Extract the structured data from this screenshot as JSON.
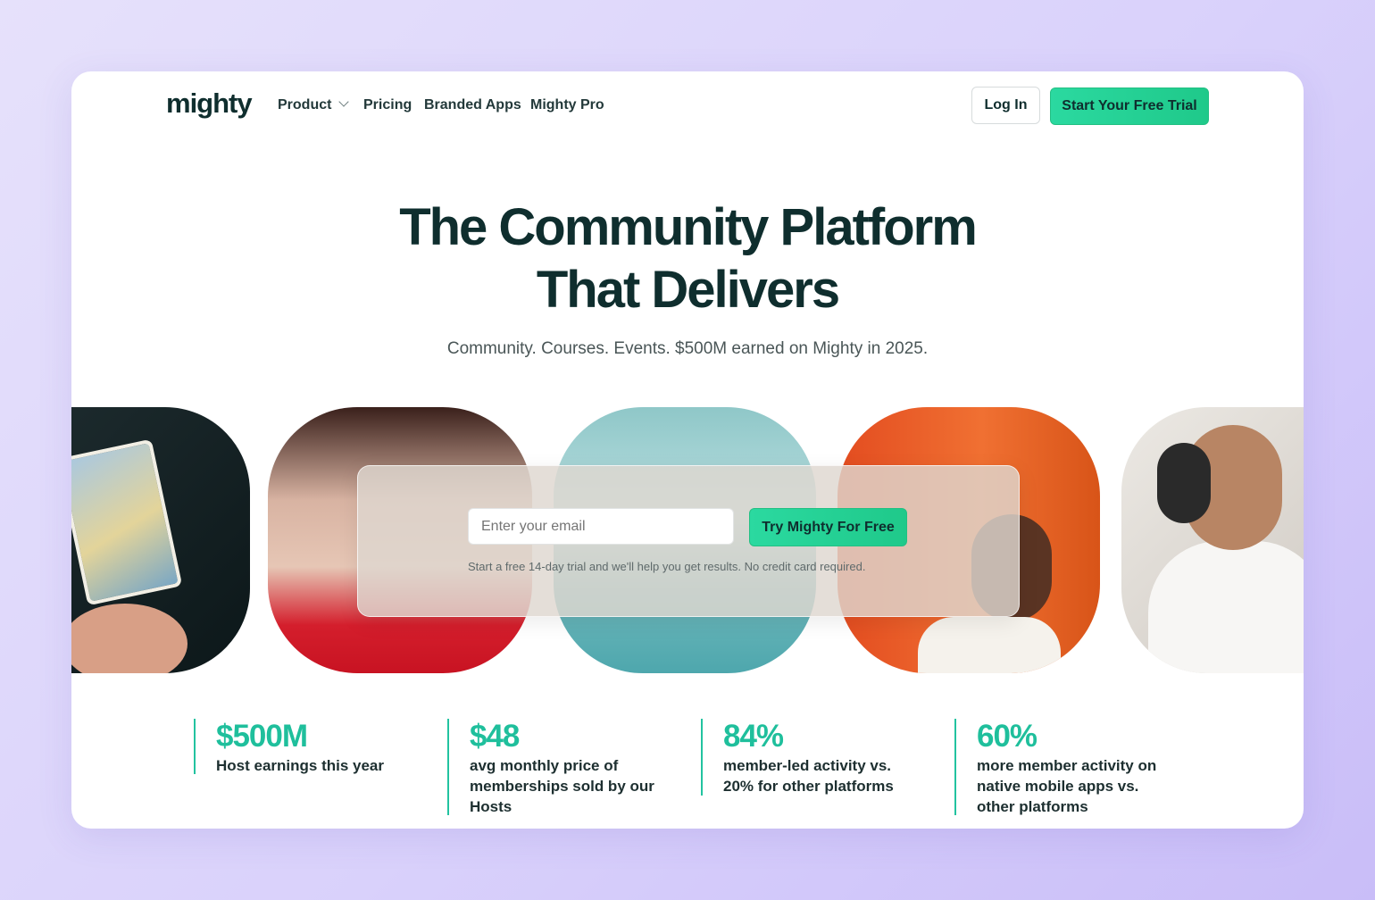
{
  "nav": {
    "logo": "mighty",
    "items": [
      {
        "label": "Product",
        "has_dropdown": true
      },
      {
        "label": "Pricing"
      },
      {
        "label": "Branded Apps"
      },
      {
        "label": "Mighty Pro"
      }
    ],
    "login_label": "Log In",
    "trial_label": "Start Your Free Trial"
  },
  "hero": {
    "title_line1": "The Community Platform",
    "title_line2": "That Delivers",
    "subtitle": "Community. Courses. Events. $500M earned on Mighty in 2025."
  },
  "signup": {
    "email_placeholder": "Enter your email",
    "cta_label": "Try Mighty For Free",
    "note": "Start a free 14-day trial and we'll help you get results. No credit card required."
  },
  "stats": [
    {
      "value": "$500M",
      "label": "Host earnings this year"
    },
    {
      "value": "$48",
      "label": "avg monthly price of\nmemberships sold by our\nHosts"
    },
    {
      "value": "84%",
      "label": "member-led activity vs.\n20% for other platforms"
    },
    {
      "value": "60%",
      "label": "more member activity on\nnative mobile apps vs.\nother platforms"
    }
  ],
  "colors": {
    "accent": "#1fbf9c",
    "cta": "#2bd9a0",
    "text_dark": "#0f2e2e",
    "background": "#d9d1fb"
  }
}
